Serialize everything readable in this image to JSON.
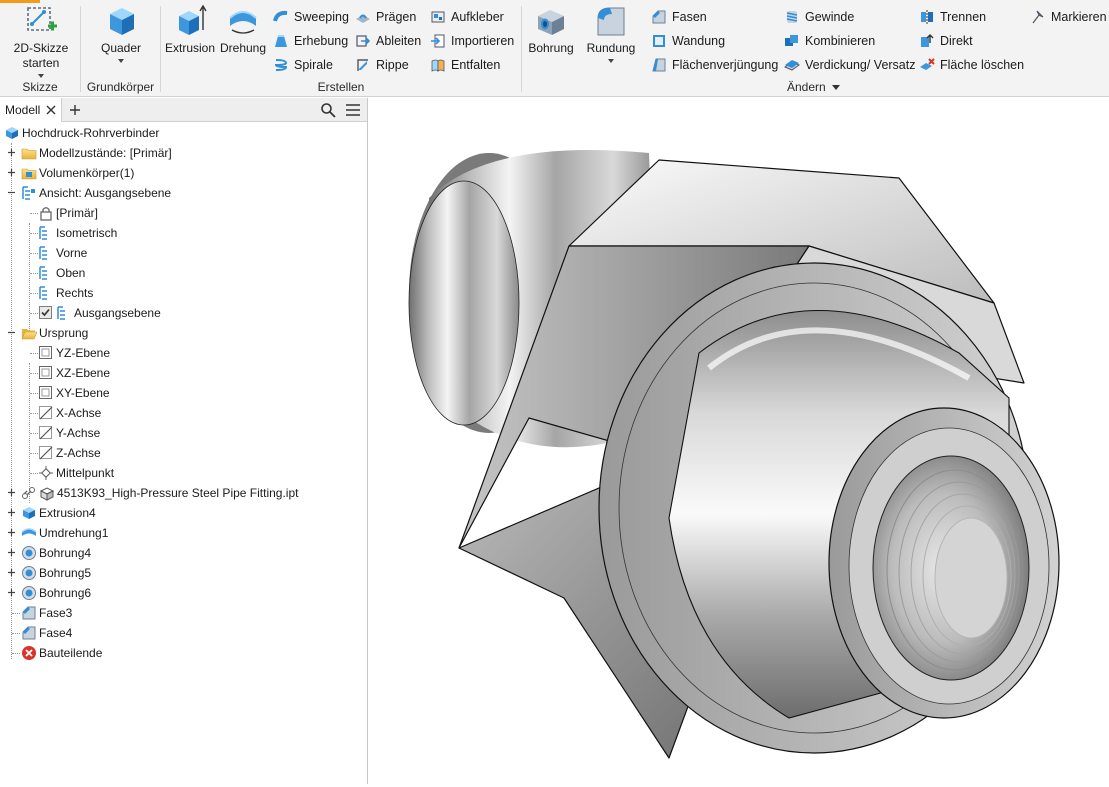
{
  "ribbon": {
    "skizze": {
      "title": "Skizze",
      "start_line1": "2D-Skizze",
      "start_line2": "starten"
    },
    "grundkoerper": {
      "title": "Grundkörper",
      "quader": "Quader"
    },
    "erstellen": {
      "title": "Erstellen",
      "extrusion": "Extrusion",
      "drehung": "Drehung",
      "sweeping": "Sweeping",
      "erhebung": "Erhebung",
      "spirale": "Spirale",
      "praegen": "Prägen",
      "ableiten": "Ableiten",
      "rippe": "Rippe",
      "aufkleber": "Aufkleber",
      "importieren": "Importieren",
      "entfalten": "Entfalten"
    },
    "aendern": {
      "title": "Ändern",
      "bohrung": "Bohrung",
      "rundung": "Rundung",
      "fasen": "Fasen",
      "wandung": "Wandung",
      "flaechenverjuengung": "Flächenverjüngung",
      "gewinde": "Gewinde",
      "kombinieren": "Kombinieren",
      "verdickung": "Verdickung/ Versatz",
      "trennen": "Trennen",
      "direkt": "Direkt",
      "flaeche_loeschen": "Fläche löschen",
      "markieren": "Markieren"
    }
  },
  "browser": {
    "tab_label": "Modell",
    "tree": [
      {
        "label": "Hochdruck-Rohrverbinder"
      },
      {
        "label": "Modellzustände: [Primär]"
      },
      {
        "label": "Volumenkörper(1)"
      },
      {
        "label": "Ansicht: Ausgangsebene"
      },
      {
        "label": "[Primär]"
      },
      {
        "label": "Isometrisch"
      },
      {
        "label": "Vorne"
      },
      {
        "label": "Oben"
      },
      {
        "label": "Rechts"
      },
      {
        "label": "Ausgangsebene"
      },
      {
        "label": "Ursprung"
      },
      {
        "label": "YZ-Ebene"
      },
      {
        "label": "XZ-Ebene"
      },
      {
        "label": "XY-Ebene"
      },
      {
        "label": "X-Achse"
      },
      {
        "label": "Y-Achse"
      },
      {
        "label": "Z-Achse"
      },
      {
        "label": "Mittelpunkt"
      },
      {
        "label": "4513K93_High-Pressure Steel Pipe Fitting.ipt"
      },
      {
        "label": "Extrusion4"
      },
      {
        "label": "Umdrehung1"
      },
      {
        "label": "Bohrung4"
      },
      {
        "label": "Bohrung5"
      },
      {
        "label": "Bohrung6"
      },
      {
        "label": "Fase3"
      },
      {
        "label": "Fase4"
      },
      {
        "label": "Bauteilende"
      }
    ]
  },
  "colors": {
    "accent": "#f29b1d",
    "icon_blue": "#2f8fd8",
    "folder_yellow": "#f2c14e",
    "error_red": "#d9342b"
  }
}
